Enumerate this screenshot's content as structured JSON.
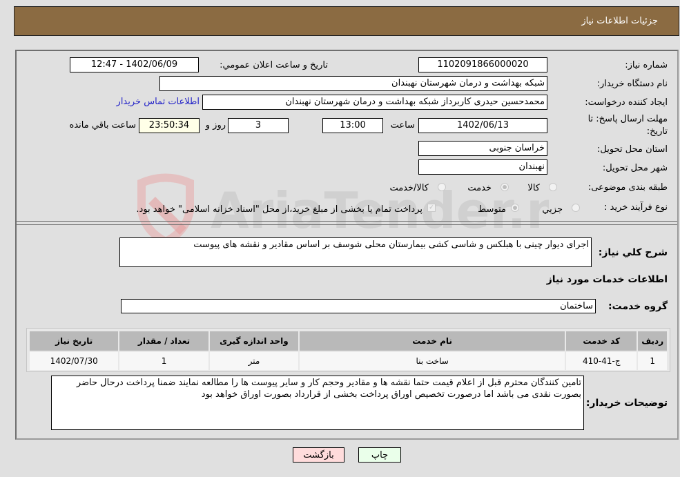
{
  "header": {
    "title": "جزئیات اطلاعات نیاز"
  },
  "form": {
    "need_number": {
      "label": "شماره نیاز:",
      "value": "1102091866000020"
    },
    "announce_datetime": {
      "label": "تاریخ و ساعت اعلان عمومي:",
      "value": "1402/06/09 - 12:47"
    },
    "buyer_org": {
      "label": "نام دستگاه خریدار:",
      "value": "شبکه بهداشت و درمان شهرستان نهبندان"
    },
    "requester": {
      "label": "ایجاد کننده درخواست:",
      "value": "محمدحسین حیدری کاربرداز شبکه بهداشت و درمان شهرستان نهبندان"
    },
    "buyer_contact_link": "اطلاعات تماس خریدار",
    "deadline": {
      "label_line1": "مهلت ارسال پاسخ: تا",
      "label_line2": "تاریخ:",
      "date": "1402/06/13",
      "time_label": "ساعت",
      "time": "13:00",
      "days": "3",
      "days_label": "روز و",
      "remaining": "23:50:34",
      "remaining_label": "ساعت باقي مانده"
    },
    "delivery_province": {
      "label": "استان محل تحویل:",
      "value": "خراسان جنوبی"
    },
    "delivery_city": {
      "label": "شهر محل تحویل:",
      "value": "نهبندان"
    },
    "category": {
      "label": "طبقه بندی موضوعی:",
      "options": [
        "کالا",
        "خدمت",
        "کالا/خدمت"
      ],
      "selected": "خدمت"
    },
    "purchase_process": {
      "label": "نوع فرآیند خرید :",
      "options": [
        "جزيي",
        "متوسط"
      ],
      "selected": "متوسط",
      "treasury_note": "پرداخت تمام یا بخشی از مبلغ خرید،از محل \"اسناد خزانه اسلامی\" خواهد بود.",
      "treasury_checked": true
    }
  },
  "description": {
    "label": "شرح كلي نياز:",
    "value": "اجرای دیوار چینی با هبلکس و شاسی کشی بیمارستان محلی شوسف بر اساس مقادیر و نقشه های پیوست"
  },
  "services_section": {
    "title": "اطلاعات خدمات مورد نیاز",
    "group_label": "گروه خدمت:",
    "group_value": "ساختمان"
  },
  "items_table": {
    "columns": [
      "ردیف",
      "کد خدمت",
      "نام خدمت",
      "واحد اندازه گیری",
      "تعداد / مقدار",
      "تاریخ نیاز"
    ],
    "rows": [
      [
        "1",
        "ج-41-410",
        "ساخت بنا",
        "متر",
        "1",
        "1402/07/30"
      ]
    ]
  },
  "buyer_notes": {
    "label": "توضیحات خریدار:",
    "value": "تامین کنندگان محترم قبل از اعلام قیمت حتما نقشه ها و مقادیر وحجم کار و سایر پیوست ها را مطالعه نمایند ضمنا پرداخت درحال حاضر بصورت نقدی می باشد اما درصورت تخصیص اوراق پرداخت بخشی از قرارداد بصورت اوراق خواهد بود"
  },
  "buttons": {
    "print": "چاپ",
    "back": "بازگشت"
  },
  "colors": {
    "header_bg": "#8b6b42",
    "print_bg": "#eaffea",
    "back_bg": "#ffdcdc",
    "link": "#2323c8"
  },
  "watermark": {
    "text": "AriaTender.neT"
  }
}
